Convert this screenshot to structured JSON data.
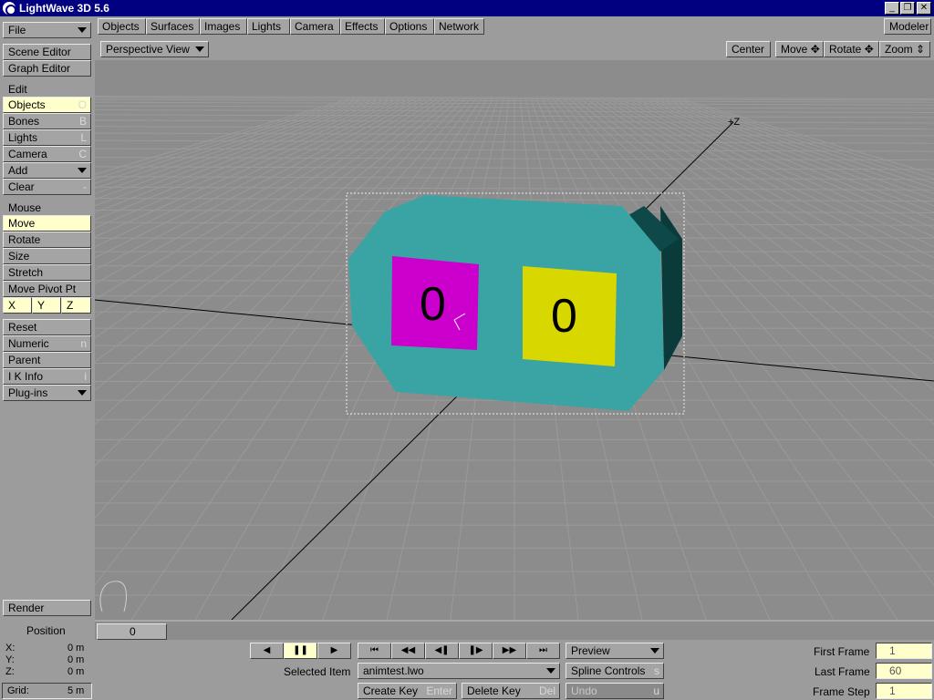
{
  "window": {
    "title": "LightWave 3D 5.6",
    "min": "_",
    "restore": "❐",
    "close": "✕"
  },
  "menu": {
    "tabs": [
      "Objects",
      "Surfaces",
      "Images",
      "Lights",
      "Camera",
      "Effects",
      "Options",
      "Network"
    ],
    "modeler": "Modeler"
  },
  "viewbar": {
    "view": "Perspective View",
    "center": "Center",
    "move": "Move",
    "rotate": "Rotate",
    "zoom": "Zoom"
  },
  "sidebar": {
    "file": "File",
    "scene_editor": "Scene Editor",
    "graph_editor": "Graph Editor",
    "edit_title": "Edit",
    "edit_items": [
      {
        "label": "Objects",
        "key": "O"
      },
      {
        "label": "Bones",
        "key": "B"
      },
      {
        "label": "Lights",
        "key": "L"
      },
      {
        "label": "Camera",
        "key": "C"
      },
      {
        "label": "Add",
        "key": ""
      },
      {
        "label": "Clear",
        "key": "-"
      }
    ],
    "mouse_title": "Mouse",
    "mouse_items": [
      "Move",
      "Rotate",
      "Size",
      "Stretch",
      "Move Pivot Pt"
    ],
    "axes": [
      "X",
      "Y",
      "Z"
    ],
    "tool_items": [
      {
        "label": "Reset",
        "key": ""
      },
      {
        "label": "Numeric",
        "key": "n"
      },
      {
        "label": "Parent",
        "key": ""
      },
      {
        "label": "I K Info",
        "key": "i"
      },
      {
        "label": "Plug-ins",
        "key": ""
      }
    ],
    "render": "Render"
  },
  "viewport": {
    "axis_label": "+Z",
    "digit_left": "0",
    "digit_right": "0",
    "colors": {
      "body": "#3aa4a4",
      "dark": "#0a3a3a",
      "left_face": "#cc00cc",
      "right_face": "#d8d800"
    }
  },
  "position": {
    "title": "Position",
    "x_label": "X:",
    "x": "0 m",
    "y_label": "Y:",
    "y": "0 m",
    "z_label": "Z:",
    "z": "0 m",
    "grid_label": "Grid:",
    "grid": "5 m"
  },
  "timeline": {
    "frame": "0"
  },
  "transport": {
    "prev": "◀",
    "pause": "❚❚",
    "play": "▶",
    "first": "⏮",
    "prev_key": "◀◀",
    "step_back": "◀❚",
    "step_fwd": "❚▶",
    "next_key": "▶▶",
    "last": "⏭"
  },
  "bottom": {
    "selected_item_label": "Selected Item",
    "selected_item": "animtest.lwo",
    "preview": "Preview",
    "spline_controls": "Spline Controls",
    "spline_key": "s",
    "create_key": "Create Key",
    "create_key_hint": "Enter",
    "delete_key": "Delete Key",
    "delete_key_hint": "Del",
    "undo": "Undo",
    "undo_hint": "u",
    "first_frame_label": "First Frame",
    "first_frame": "1",
    "last_frame_label": "Last Frame",
    "last_frame": "60",
    "frame_step_label": "Frame Step",
    "frame_step": "1"
  }
}
